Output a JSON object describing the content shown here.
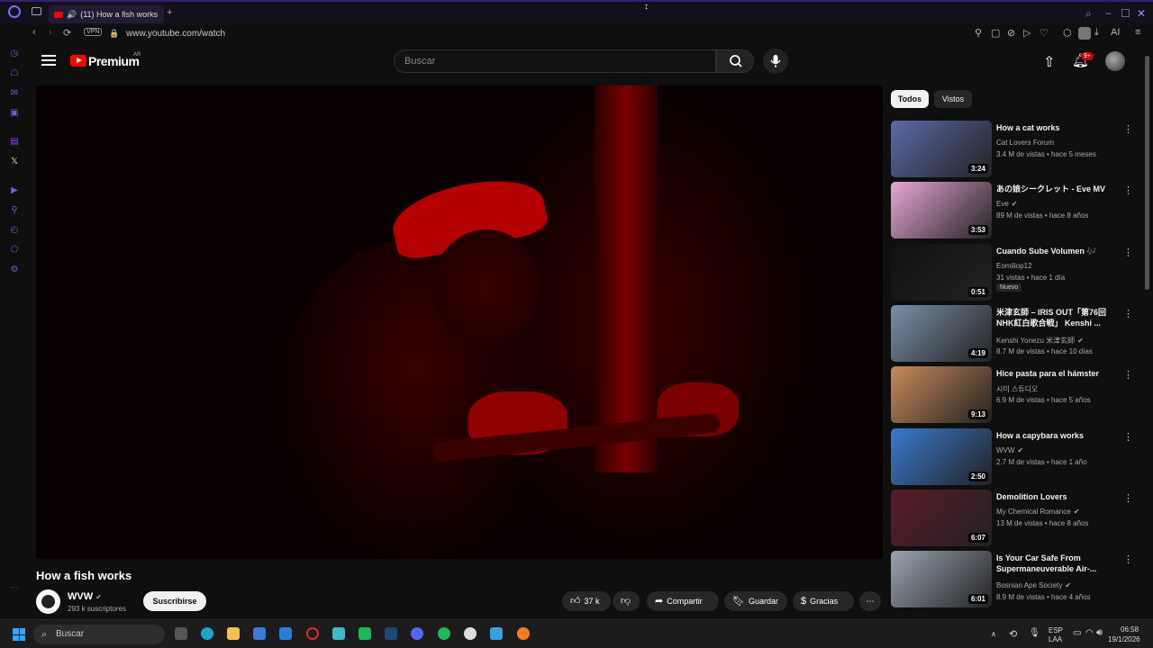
{
  "browser": {
    "tab_title": "(11) How a fish works",
    "new_tab_symbol": "+",
    "vpn_label": "VPN",
    "url": "www.youtube.com/watch",
    "ai_label": "AI"
  },
  "header": {
    "logo_text": "Premium",
    "logo_region": "AR",
    "search_placeholder": "Buscar",
    "notification_count": "9+"
  },
  "video": {
    "title": "How a fish works",
    "channel": "WVW",
    "subscribers": "293 k suscriptores",
    "subscribe_label": "Suscribirse",
    "likes": "37 k",
    "share_label": "Compartir",
    "save_label": "Guardar",
    "thanks_label": "Gracias"
  },
  "filters": [
    "Todos",
    "Vistos"
  ],
  "recommendations": [
    {
      "title": "How a cat works",
      "channel": "Cat Lovers Forum",
      "meta": "3.4 M de vistas • hace 5 meses",
      "duration": "3:24",
      "verified": false,
      "color": "#5a6aa8"
    },
    {
      "title": "あの娘シークレット - Eve MV",
      "channel": "Eve",
      "meta": "89 M de vistas • hace 8 años",
      "duration": "3:53",
      "verified": true,
      "color": "#e9a7d8"
    },
    {
      "title": "Cuando Sube Volumen 🎶",
      "channel": "Eomiliop12",
      "meta": "31 vistas • hace 1 día",
      "duration": "0:51",
      "verified": false,
      "badge": "Nuevo",
      "color": "#111111"
    },
    {
      "title": "米津玄師 – IRIS OUT「第76回NHK紅白歌合戦」 Kenshi ...",
      "channel": "Kenshi Yonezu 米津玄師",
      "meta": "8.7 M de vistas • hace 10 días",
      "duration": "4:19",
      "verified": true,
      "color": "#7a8fa8"
    },
    {
      "title": "Hice pasta para el hámster",
      "channel": "시미 스튜디오",
      "meta": "6.9 M de vistas • hace 5 años",
      "duration": "9:13",
      "verified": false,
      "color": "#c88a5a"
    },
    {
      "title": "How a capybara works",
      "channel": "WVW",
      "meta": "2.7 M de vistas • hace 1 año",
      "duration": "2:50",
      "verified": true,
      "color": "#3a7ad0"
    },
    {
      "title": "Demolition Lovers",
      "channel": "My Chemical Romance",
      "meta": "13 M de vistas • hace 8 años",
      "duration": "6:07",
      "verified": true,
      "color": "#5a1a2a"
    },
    {
      "title": "Is Your Car Safe From Supermaneuverable Air-...",
      "channel": "Bosnian Ape Society",
      "meta": "8.9 M de vistas • hace 4 años",
      "duration": "6:01",
      "verified": true,
      "color": "#9aa4b2"
    }
  ],
  "taskbar": {
    "search_placeholder": "Buscar",
    "lang_top": "ESP",
    "lang_bottom": "LAA",
    "time": "06:58",
    "date": "19/1/2026"
  },
  "icons": {
    "verified": "check-circle-icon",
    "more": "more-vert-icon"
  }
}
